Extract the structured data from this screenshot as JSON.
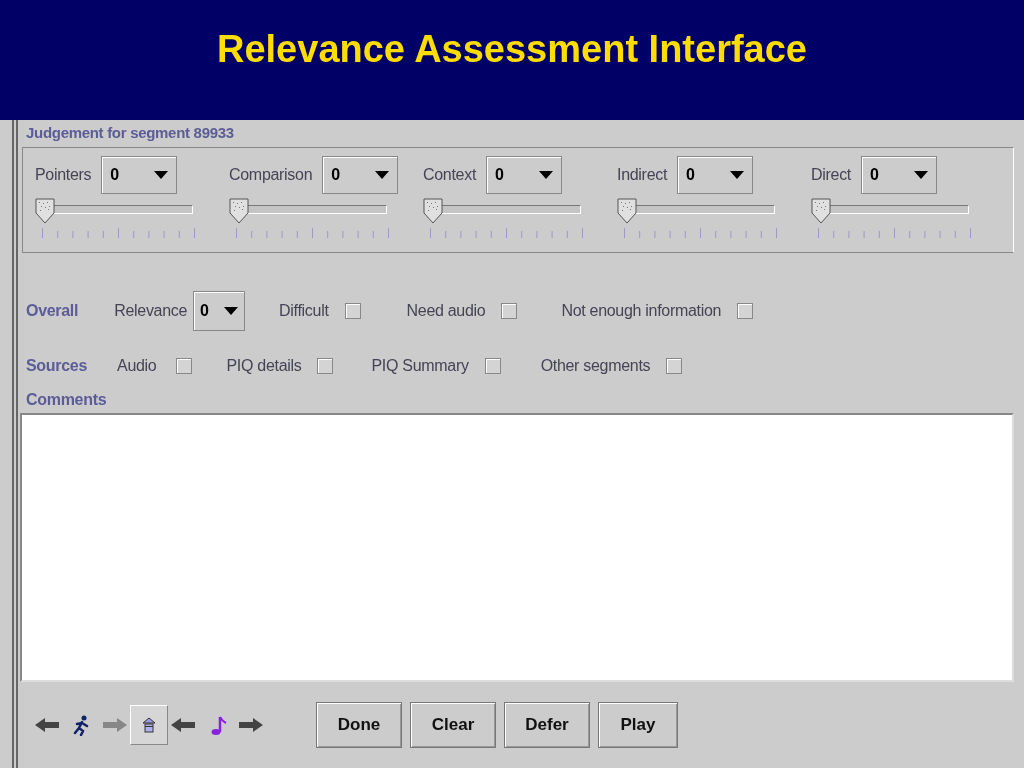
{
  "slide_title": "Relevance Assessment Interface",
  "panel_title": "Judgement for segment 89933",
  "criteria": [
    {
      "label": "Pointers",
      "value": "0",
      "level": 0
    },
    {
      "label": "Comparison",
      "value": "0",
      "level": 0
    },
    {
      "label": "Context",
      "value": "0",
      "level": 0
    },
    {
      "label": "Indirect",
      "value": "0",
      "level": 0
    },
    {
      "label": "Direct",
      "value": "0",
      "level": 0
    }
  ],
  "overall": {
    "label": "Overall",
    "relevance_label": "Relevance",
    "relevance_value": "0",
    "flags": [
      {
        "label": "Difficult",
        "checked": false
      },
      {
        "label": "Need audio",
        "checked": false
      },
      {
        "label": "Not enough information",
        "checked": false
      }
    ]
  },
  "sources": {
    "label": "Sources",
    "items": [
      {
        "label": "Audio",
        "checked": false
      },
      {
        "label": "PIQ details",
        "checked": false
      },
      {
        "label": "PIQ Summary",
        "checked": false
      },
      {
        "label": "Other segments",
        "checked": false
      }
    ]
  },
  "comments": {
    "label": "Comments"
  },
  "toolbar": [
    {
      "kind": "back",
      "disabled": false,
      "selected": false
    },
    {
      "kind": "runner",
      "disabled": false,
      "selected": false
    },
    {
      "kind": "forward",
      "disabled": true,
      "selected": false
    },
    {
      "kind": "home",
      "disabled": false,
      "selected": true
    },
    {
      "kind": "back",
      "disabled": false,
      "selected": false
    },
    {
      "kind": "note",
      "disabled": false,
      "selected": false
    },
    {
      "kind": "forward",
      "disabled": false,
      "selected": false
    }
  ],
  "buttons": [
    "Done",
    "Clear",
    "Defer",
    "Play"
  ]
}
